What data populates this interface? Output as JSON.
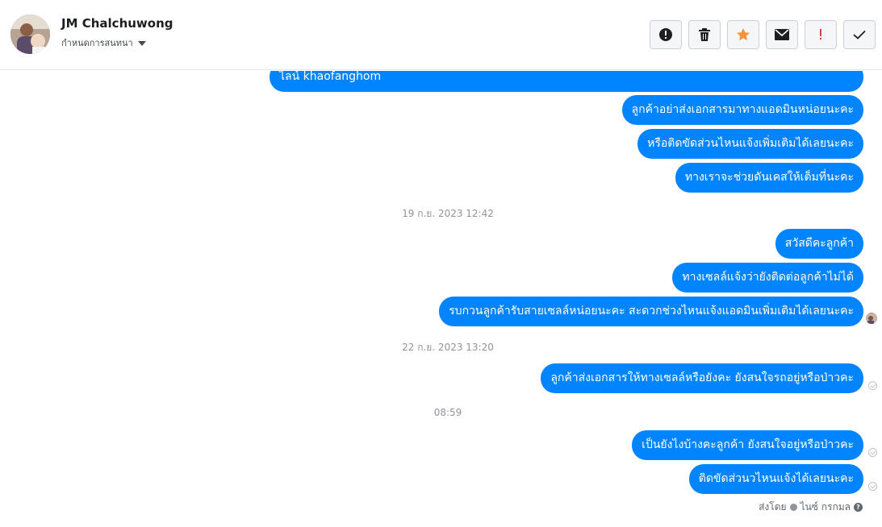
{
  "header": {
    "contact_name": "JM Chalchuwong",
    "assign_label": "กำหนดการสนทนา",
    "actions": [
      "mark-spam",
      "delete",
      "star",
      "mark-unread",
      "important",
      "done"
    ]
  },
  "messages": [
    {
      "text": "ไลน์  khaofanghom"
    },
    {
      "text": "ลูกค้าอย่าส่งเอกสารมาทางแอดมินหน่อยนะคะ"
    },
    {
      "text": "หรือติดขัดส่วนไหนแจ้งเพิ่มเติมได้เลยนะคะ"
    },
    {
      "text": "ทางเราจะช่วยดันเคสให้เต็มที่นะคะ"
    },
    {
      "timestamp": "19 ก.ย. 2023 12:42"
    },
    {
      "text": "สวัสดีคะลูกค้า"
    },
    {
      "text": "ทางเซลล์แจ้งว่ายังติดต่อลูกค้าไม่ได้"
    },
    {
      "text": "รบกวนลูกค้ารับสายเซลล์หน่อยนะคะ สะดวกช่วงไหนแจ้งแอดมินเพิ่มเติมได้เลยนะคะ"
    },
    {
      "timestamp": "22 ก.ย. 2023 13:20"
    },
    {
      "text": "ลูกค้าส่งเอกสารให้ทางเซลล์หรือยังคะ ยังสนใจรถอยู่หรือป่าวคะ"
    },
    {
      "timestamp": "08:59"
    },
    {
      "text": "เป็นยังไงบ้างคะลูกค้า ยังสนใจอยู่หรือป่าวคะ"
    },
    {
      "text": "ติดขัดส่วนวไหนแจ้งได้เลยนะคะ"
    }
  ],
  "footer": {
    "sent_by_label": "ส่งโดย",
    "sender_name": "ไนซ์ กรกมล",
    "help_icon": "?"
  },
  "colors": {
    "bubble": "#0084ff",
    "star": "#f7923b",
    "important": "#e0393e"
  }
}
